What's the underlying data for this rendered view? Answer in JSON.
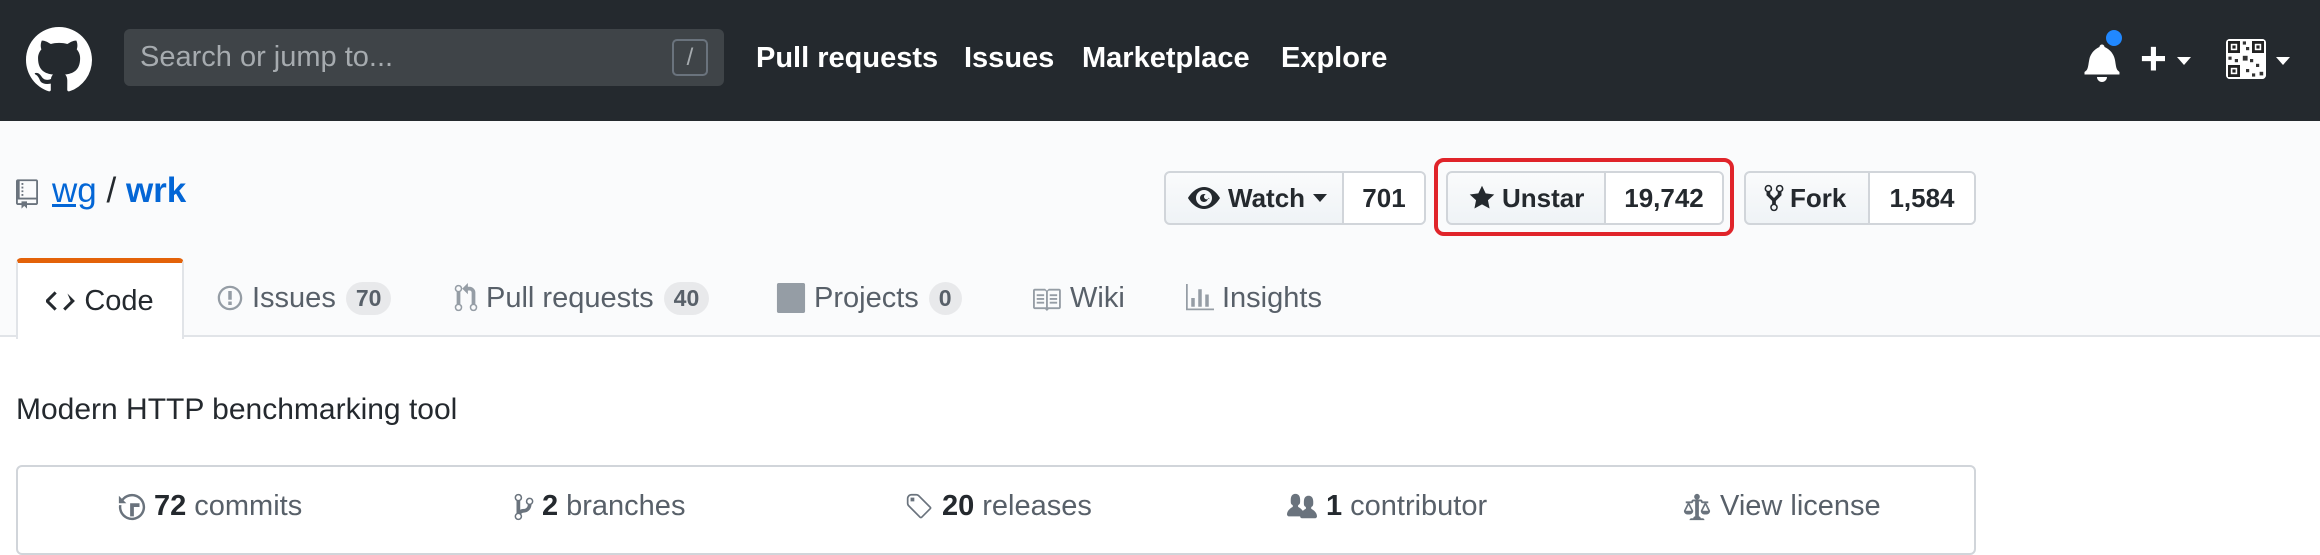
{
  "header": {
    "search_placeholder": "Search or jump to...",
    "search_shortcut": "/",
    "nav": [
      "Pull requests",
      "Issues",
      "Marketplace",
      "Explore"
    ],
    "plus": "+"
  },
  "repo": {
    "owner": "wg",
    "separator": "/",
    "name": "wrk",
    "watch_label": "Watch",
    "watch_count": "701",
    "star_label": "Unstar",
    "star_count": "19,742",
    "fork_label": "Fork",
    "fork_count": "1,584"
  },
  "tabs": [
    {
      "label": "Code"
    },
    {
      "label": "Issues",
      "count": "70"
    },
    {
      "label": "Pull requests",
      "count": "40"
    },
    {
      "label": "Projects",
      "count": "0"
    },
    {
      "label": "Wiki"
    },
    {
      "label": "Insights"
    }
  ],
  "description": "Modern HTTP benchmarking tool",
  "summary": {
    "commits_count": "72",
    "commits_label": "commits",
    "branches_count": "2",
    "branches_label": "branches",
    "releases_count": "20",
    "releases_label": "releases",
    "contributors_count": "1",
    "contributors_label": "contributor",
    "license_label": "View license"
  },
  "colors": {
    "header_bg": "#24292e",
    "link": "#0366d6",
    "tab_accent": "#e36209",
    "highlight_box": "#e0242a",
    "notification_dot": "#2188ff"
  },
  "icons": [
    "github-logo-icon",
    "bell-icon",
    "plus-icon",
    "avatar",
    "repo-icon",
    "eye-icon",
    "star-icon",
    "fork-icon",
    "code-icon",
    "issue-icon",
    "pull-request-icon",
    "project-icon",
    "wiki-icon",
    "graph-icon",
    "history-icon",
    "branch-icon",
    "tag-icon",
    "people-icon",
    "law-icon"
  ]
}
